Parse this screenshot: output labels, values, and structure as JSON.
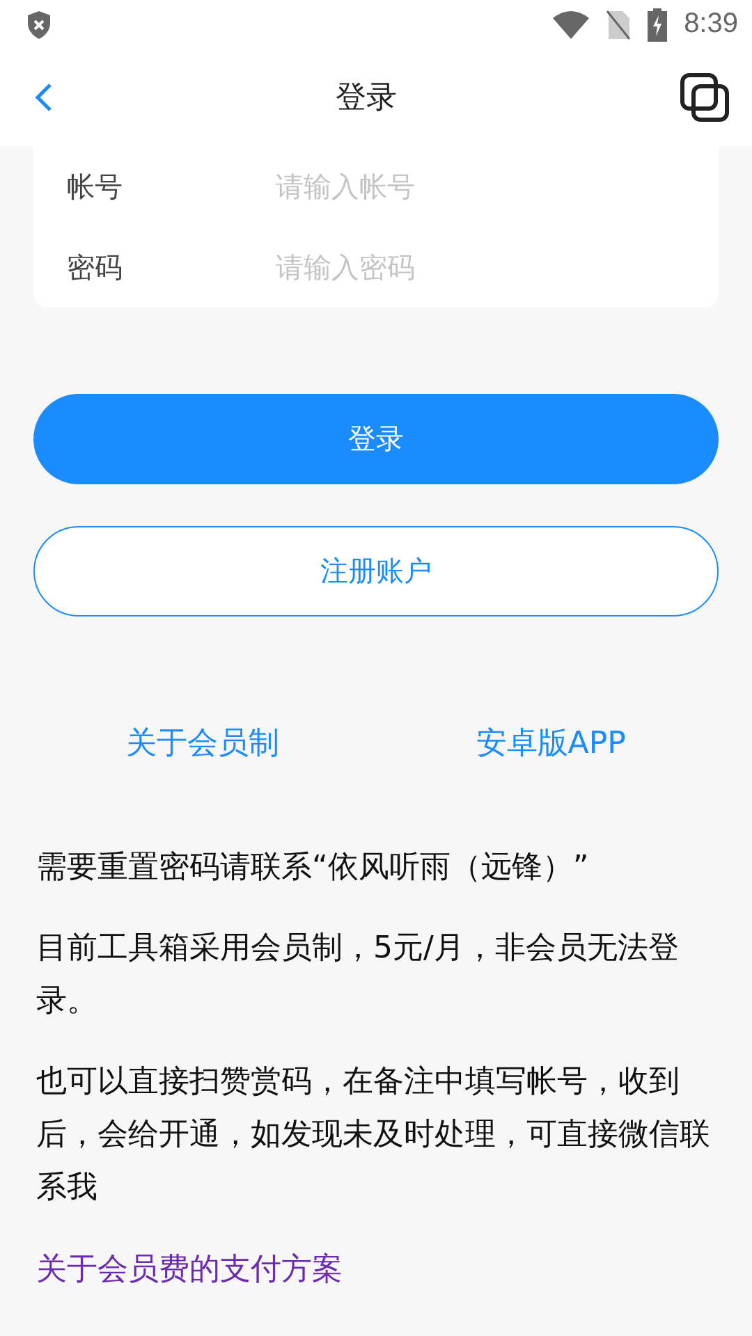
{
  "status_bar": {
    "time": "8:39"
  },
  "nav": {
    "title": "登录"
  },
  "form": {
    "fields": [
      {
        "label": "帐号",
        "placeholder": "请输入帐号"
      },
      {
        "label": "密码",
        "placeholder": "请输入密码"
      }
    ]
  },
  "buttons": [
    {
      "kind": "primary",
      "label": "登录"
    },
    {
      "kind": "outline",
      "label": "注册账户"
    }
  ],
  "links": [
    "关于会员制",
    "安卓版APP"
  ],
  "notes": [
    "需要重置密码请联系“依风听雨（远锋）”",
    "目前工具箱采用会员制，5元/月，非会员无法登录。",
    "也可以直接扫赞赏码，在备注中填写帐号，收到后，会给开通，如发现未及时处理，可直接微信联系我"
  ],
  "payment_link": "关于会员费的支付方案"
}
